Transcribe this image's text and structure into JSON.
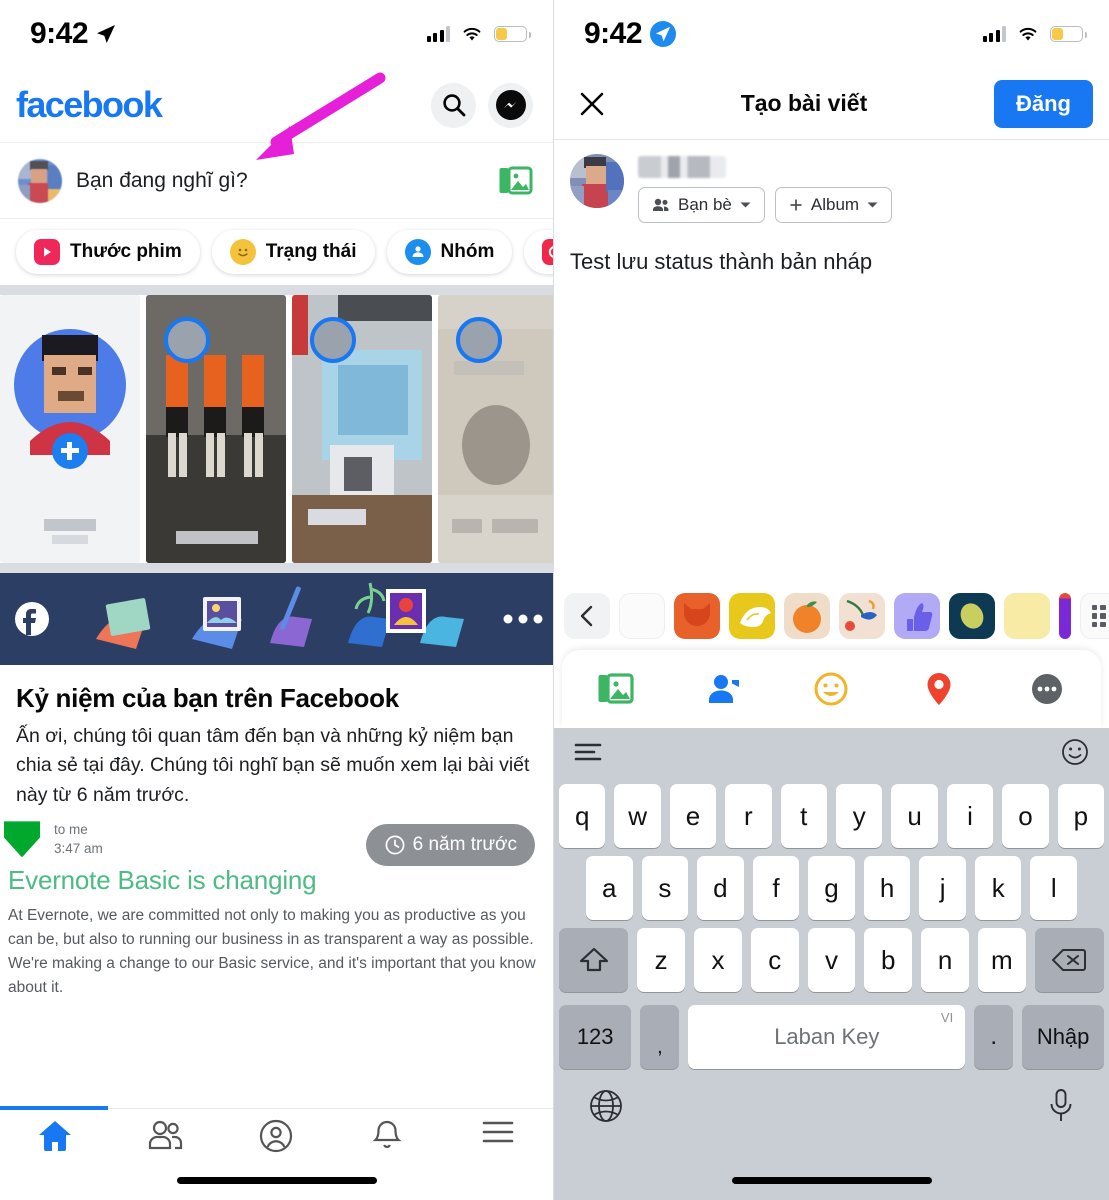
{
  "left_phone": {
    "status_bar": {
      "time": "9:42",
      "location_icon": "location-arrow-icon",
      "signal": "cellular-bars-icon",
      "wifi": "wifi-icon",
      "battery": "battery-low-icon"
    },
    "header": {
      "logo_text": "facebook",
      "search_icon": "search-icon",
      "messenger_icon": "messenger-icon"
    },
    "composer": {
      "avatar": "user-avatar",
      "placeholder": "Bạn đang nghĩ gì?",
      "photo_icon": "photo-library-icon"
    },
    "shortcut_chips": [
      {
        "label": "Thước phim",
        "icon": "reels-icon",
        "color": "#f0285a"
      },
      {
        "label": "Trạng thái",
        "icon": "smiley-status-icon",
        "color": "#f5c33b"
      },
      {
        "label": "Nhóm",
        "icon": "groups-icon",
        "color": "#1c8ef0"
      },
      {
        "label": "",
        "icon": "live-video-icon",
        "color": "#f02849"
      }
    ],
    "stories": [
      {
        "name": "create-story",
        "label": ""
      },
      {
        "name": "story-1",
        "label": ""
      },
      {
        "name": "story-2",
        "label": ""
      },
      {
        "name": "story-3",
        "label": ""
      }
    ],
    "memories_post": {
      "banner_icon": "facebook-logo-icon",
      "more_icon": "more-options-icon",
      "title": "Kỷ niệm của bạn trên Facebook",
      "body": "Ấn ơi, chúng tôi quan tâm đến bạn và những kỷ niệm bạn chia sẻ tại đây. Chúng tôi nghĩ bạn sẽ muốn xem lại bài viết này từ 6 năm trước.",
      "mail_recipient": "to me",
      "mail_time": "3:47 am",
      "time_badge": "6 năm trước",
      "time_badge_icon": "clock-icon",
      "evernote_title": "Evernote Basic is changing",
      "evernote_body": "At Evernote, we are committed not only to making you as productive as you can be, but also to running our business in as transparent a way as possible. We're making a change to our Basic service, and it's important that you know about it."
    },
    "bottom_nav": [
      {
        "name": "home",
        "icon": "home-icon",
        "active": true
      },
      {
        "name": "friends",
        "icon": "friends-icon",
        "active": false
      },
      {
        "name": "profile",
        "icon": "profile-circle-icon",
        "active": false
      },
      {
        "name": "notifications",
        "icon": "bell-icon",
        "active": false
      },
      {
        "name": "menu",
        "icon": "hamburger-menu-icon",
        "active": false
      }
    ],
    "annotation": {
      "type": "arrow",
      "color": "#e520d8",
      "points_to": "composer-placeholder"
    }
  },
  "right_phone": {
    "status_bar": {
      "time": "9:42",
      "location_icon": "location-badge-icon",
      "signal": "cellular-bars-icon",
      "wifi": "wifi-icon",
      "battery": "battery-low-icon"
    },
    "header": {
      "close_icon": "close-icon",
      "title": "Tạo bài viết",
      "post_button": "Đăng"
    },
    "author": {
      "avatar": "user-avatar",
      "name": "",
      "audience_chip": {
        "label": "Bạn bè",
        "icon": "friends-icon",
        "chevron": "chevron-down-icon"
      },
      "album_chip": {
        "label": "Album",
        "icon": "plus-icon",
        "chevron": "chevron-down-icon"
      }
    },
    "post_text": "Test lưu status thành bản nháp",
    "sticker_strip": {
      "back_icon": "chevron-left-icon",
      "grid_icon": "sticker-grid-icon",
      "stickers": [
        "blank-sticker",
        "cat-sticker",
        "dove-sticker",
        "orange-sticker",
        "bird-flower-sticker",
        "thumbsup-sticker",
        "lemon-sticker",
        "yellow-sticker",
        "purple-sticker"
      ]
    },
    "attachment_bar": [
      {
        "name": "photo",
        "icon": "photo-library-icon",
        "color": "#45bd62"
      },
      {
        "name": "tag-people",
        "icon": "tag-friends-icon",
        "color": "#1877f2"
      },
      {
        "name": "feeling",
        "icon": "feeling-smiley-icon",
        "color": "#f5c33b"
      },
      {
        "name": "location",
        "icon": "location-pin-icon",
        "color": "#f5533d"
      },
      {
        "name": "more",
        "icon": "more-dots-icon",
        "color": "#606770"
      }
    ],
    "keyboard": {
      "toolbar": {
        "menu_icon": "keyboard-menu-icon",
        "emoji_icon": "emoji-smiley-icon"
      },
      "row1": [
        "q",
        "w",
        "e",
        "r",
        "t",
        "y",
        "u",
        "i",
        "o",
        "p"
      ],
      "row2": [
        "a",
        "s",
        "d",
        "f",
        "g",
        "h",
        "j",
        "k",
        "l"
      ],
      "row3_shift": "shift-icon",
      "row3": [
        "z",
        "x",
        "c",
        "v",
        "b",
        "n",
        "m"
      ],
      "row3_backspace": "backspace-icon",
      "row4": {
        "numbers": "123",
        "comma": ",",
        "space_label": "Laban Key",
        "space_badge": "VI",
        "period": ".",
        "enter": "Nhập"
      },
      "bottom": {
        "globe_icon": "globe-icon",
        "mic_icon": "microphone-icon"
      }
    }
  }
}
